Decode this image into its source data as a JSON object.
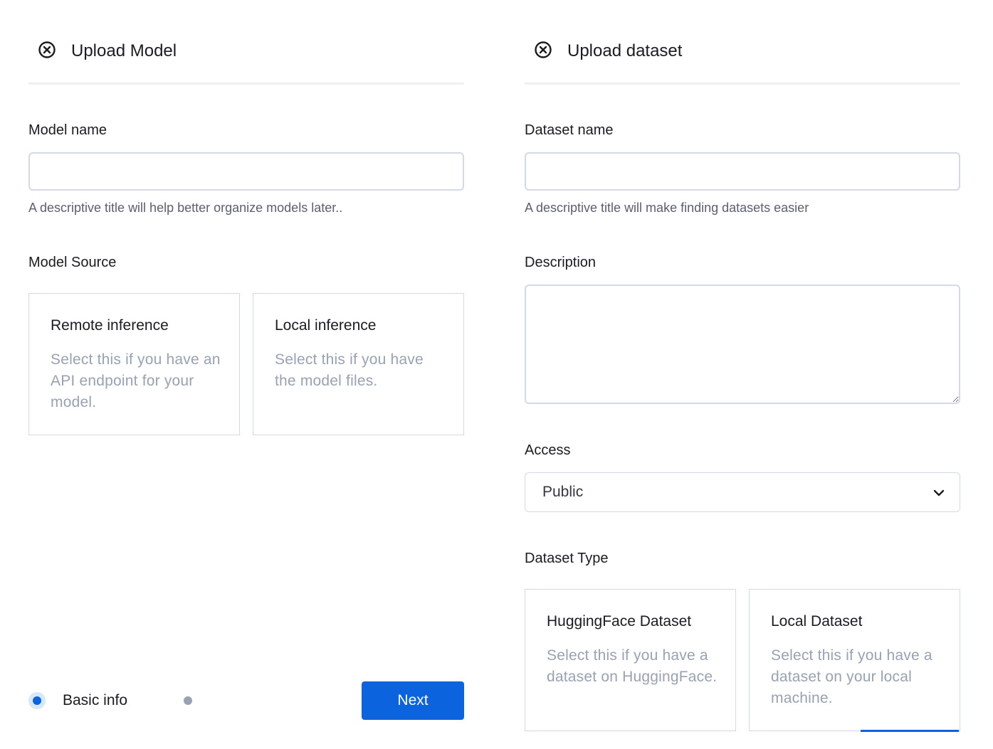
{
  "upload_model": {
    "title": "Upload Model",
    "close_icon": "close-circle-icon",
    "model_name": {
      "label": "Model name",
      "value": "",
      "placeholder": "",
      "help": "A descriptive title will help better organize models later.."
    },
    "model_source": {
      "label": "Model Source",
      "options": [
        {
          "title": "Remote inference",
          "description": "Select this if you have an API endpoint for your model."
        },
        {
          "title": "Local inference",
          "description": "Select this if you have the model files."
        }
      ]
    },
    "steps": {
      "current_label": "Basic info",
      "active_color": "#0b64dd",
      "inactive_color": "#98a2b3"
    },
    "next_label": "Next"
  },
  "upload_dataset": {
    "title": "Upload dataset",
    "close_icon": "close-circle-icon",
    "dataset_name": {
      "label": "Dataset name",
      "value": "",
      "placeholder": "",
      "help": "A descriptive title will make finding datasets easier"
    },
    "description": {
      "label": "Description",
      "value": ""
    },
    "access": {
      "label": "Access",
      "selected": "Public",
      "icon": "chevron-down-icon"
    },
    "dataset_type": {
      "label": "Dataset Type",
      "options": [
        {
          "title": "HuggingFace Dataset",
          "description": "Select this if you have a dataset on HuggingFace."
        },
        {
          "title": "Local Dataset",
          "description": "Select this if you have a dataset on your local machine."
        }
      ]
    }
  },
  "colors": {
    "accent": "#0b64dd",
    "border": "#d3dae6",
    "muted_text": "#98a2b3"
  }
}
